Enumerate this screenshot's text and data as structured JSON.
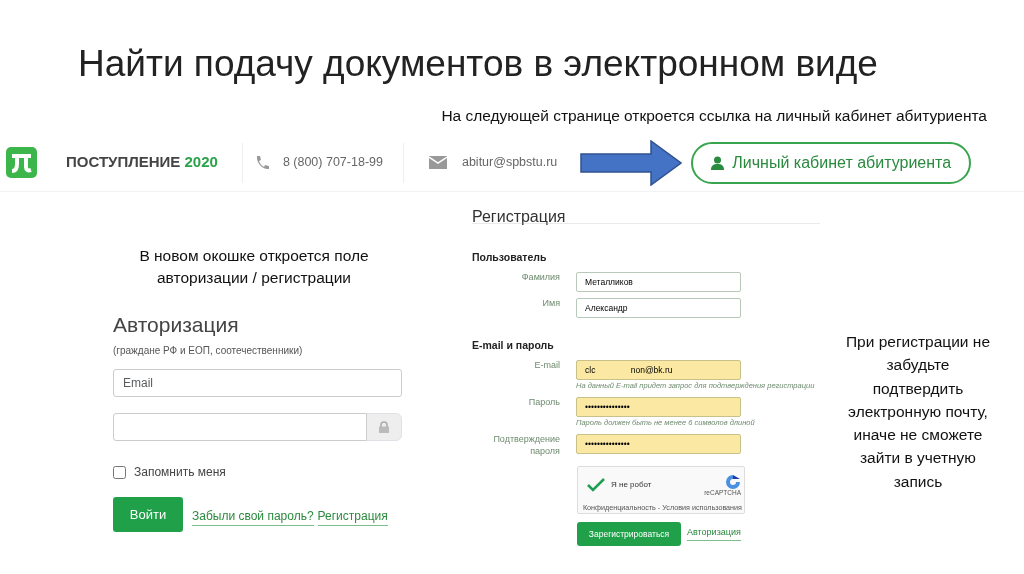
{
  "title": "Найти подачу документов в электронном виде",
  "note_top": "На следующей странице откроется ссылка на личный кабинет абитуриента",
  "site_header": {
    "brand": "ПОСТУПЛЕНИЕ",
    "brand_year": "2020",
    "phone": "8 (800) 707-18-99",
    "email": "abitur@spbstu.ru",
    "cabinet_button": "Личный кабинет абитуриента"
  },
  "note_left": "В новом окошке откроется поле авторизации / регистрации",
  "login": {
    "title": "Авторизация",
    "subtitle": "(граждане РФ и ЕОП, соотечественники)",
    "email_placeholder": "Email",
    "remember": {
      "label": "Запомнить меня",
      "checked": false
    },
    "submit": "Войти",
    "links": [
      "Забыли свой пароль?",
      "Регистрация"
    ]
  },
  "registration": {
    "title": "Регистрация",
    "sections": [
      {
        "heading": "Пользователь",
        "fields": [
          {
            "label": "Фамилия",
            "value": "Металликов",
            "autofilled": false
          },
          {
            "label": "Имя",
            "value": "Александр",
            "autofilled": false
          }
        ]
      },
      {
        "heading": "E-mail и пароль",
        "fields": [
          {
            "label": "E-mail",
            "value": "clc               non@bk.ru",
            "autofilled": true,
            "hint": "На данный E-mail придет запрос для подтверждения регистрации"
          },
          {
            "label": "Пароль",
            "value": "•••••••••••••••",
            "autofilled": true,
            "hint": "Пароль должен быть не менее 6 символов длиной"
          },
          {
            "label": "Подтверждение пароля",
            "value": "•••••••••••••••",
            "autofilled": true
          }
        ]
      }
    ],
    "captcha": {
      "label": "Я не робот",
      "checked": true,
      "brand": "reCAPTCHA",
      "footer": "Конфиденциальность - Условия использования"
    },
    "submit": "Зарегистрироваться",
    "link": "Авторизация"
  },
  "note_right": "При регистрации не забудьте подтвердить электронную почту, иначе не сможете зайти в учетную запись"
}
